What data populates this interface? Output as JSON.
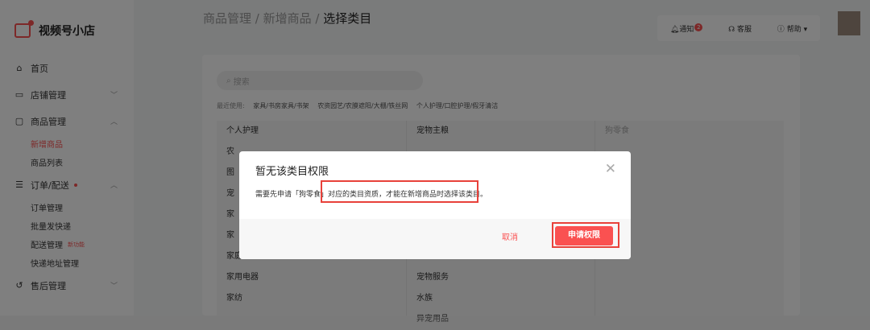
{
  "brand": {
    "name": "视频号小店"
  },
  "sidebar": {
    "items": [
      {
        "label": "首页",
        "icon": "home-icon"
      },
      {
        "label": "店铺管理",
        "icon": "store-icon"
      },
      {
        "label": "商品管理",
        "icon": "bag-icon"
      },
      {
        "label": "新增商品"
      },
      {
        "label": "商品列表"
      },
      {
        "label": "订单/配送",
        "icon": "order-icon"
      },
      {
        "label": "订单管理"
      },
      {
        "label": "批量发快递"
      },
      {
        "label": "配送管理",
        "tag": "新功能"
      },
      {
        "label": "快递地址管理"
      },
      {
        "label": "售后管理",
        "icon": "aftersale-icon"
      }
    ]
  },
  "breadcrumb": {
    "path": "商品管理 / 新增商品 / ",
    "current": "选择类目"
  },
  "topbar": {
    "notify": "通知",
    "notify_count": "2",
    "service": "客服",
    "help": "帮助"
  },
  "search": {
    "placeholder": "搜索"
  },
  "recent": {
    "label": "最近使用:",
    "items": [
      "家具/书房家具/书架",
      "农资园艺/农膜遮阳/大棚/铁丝网",
      "个人护理/口腔护理/假牙清洁"
    ]
  },
  "categories": {
    "col1": [
      "个人护理",
      "农",
      "图",
      "宠",
      "家",
      "家",
      "家庭清洁/纸品",
      "家用电器",
      "家纺"
    ],
    "col2": [
      "宠物主粮",
      "宠物服务",
      "水族",
      "异宠用品"
    ],
    "col3": [
      "狗零食"
    ]
  },
  "modal": {
    "title": "暂无该类目权限",
    "body_prefix": "需要先申请「狗零食」",
    "body_highlight": "对应的类目资质，才能在新增商品时选择该类目。",
    "cancel_label": "取消",
    "apply_label": "申请权限"
  },
  "colors": {
    "accent": "#fa5151",
    "highlight_box": "#e8413a"
  }
}
